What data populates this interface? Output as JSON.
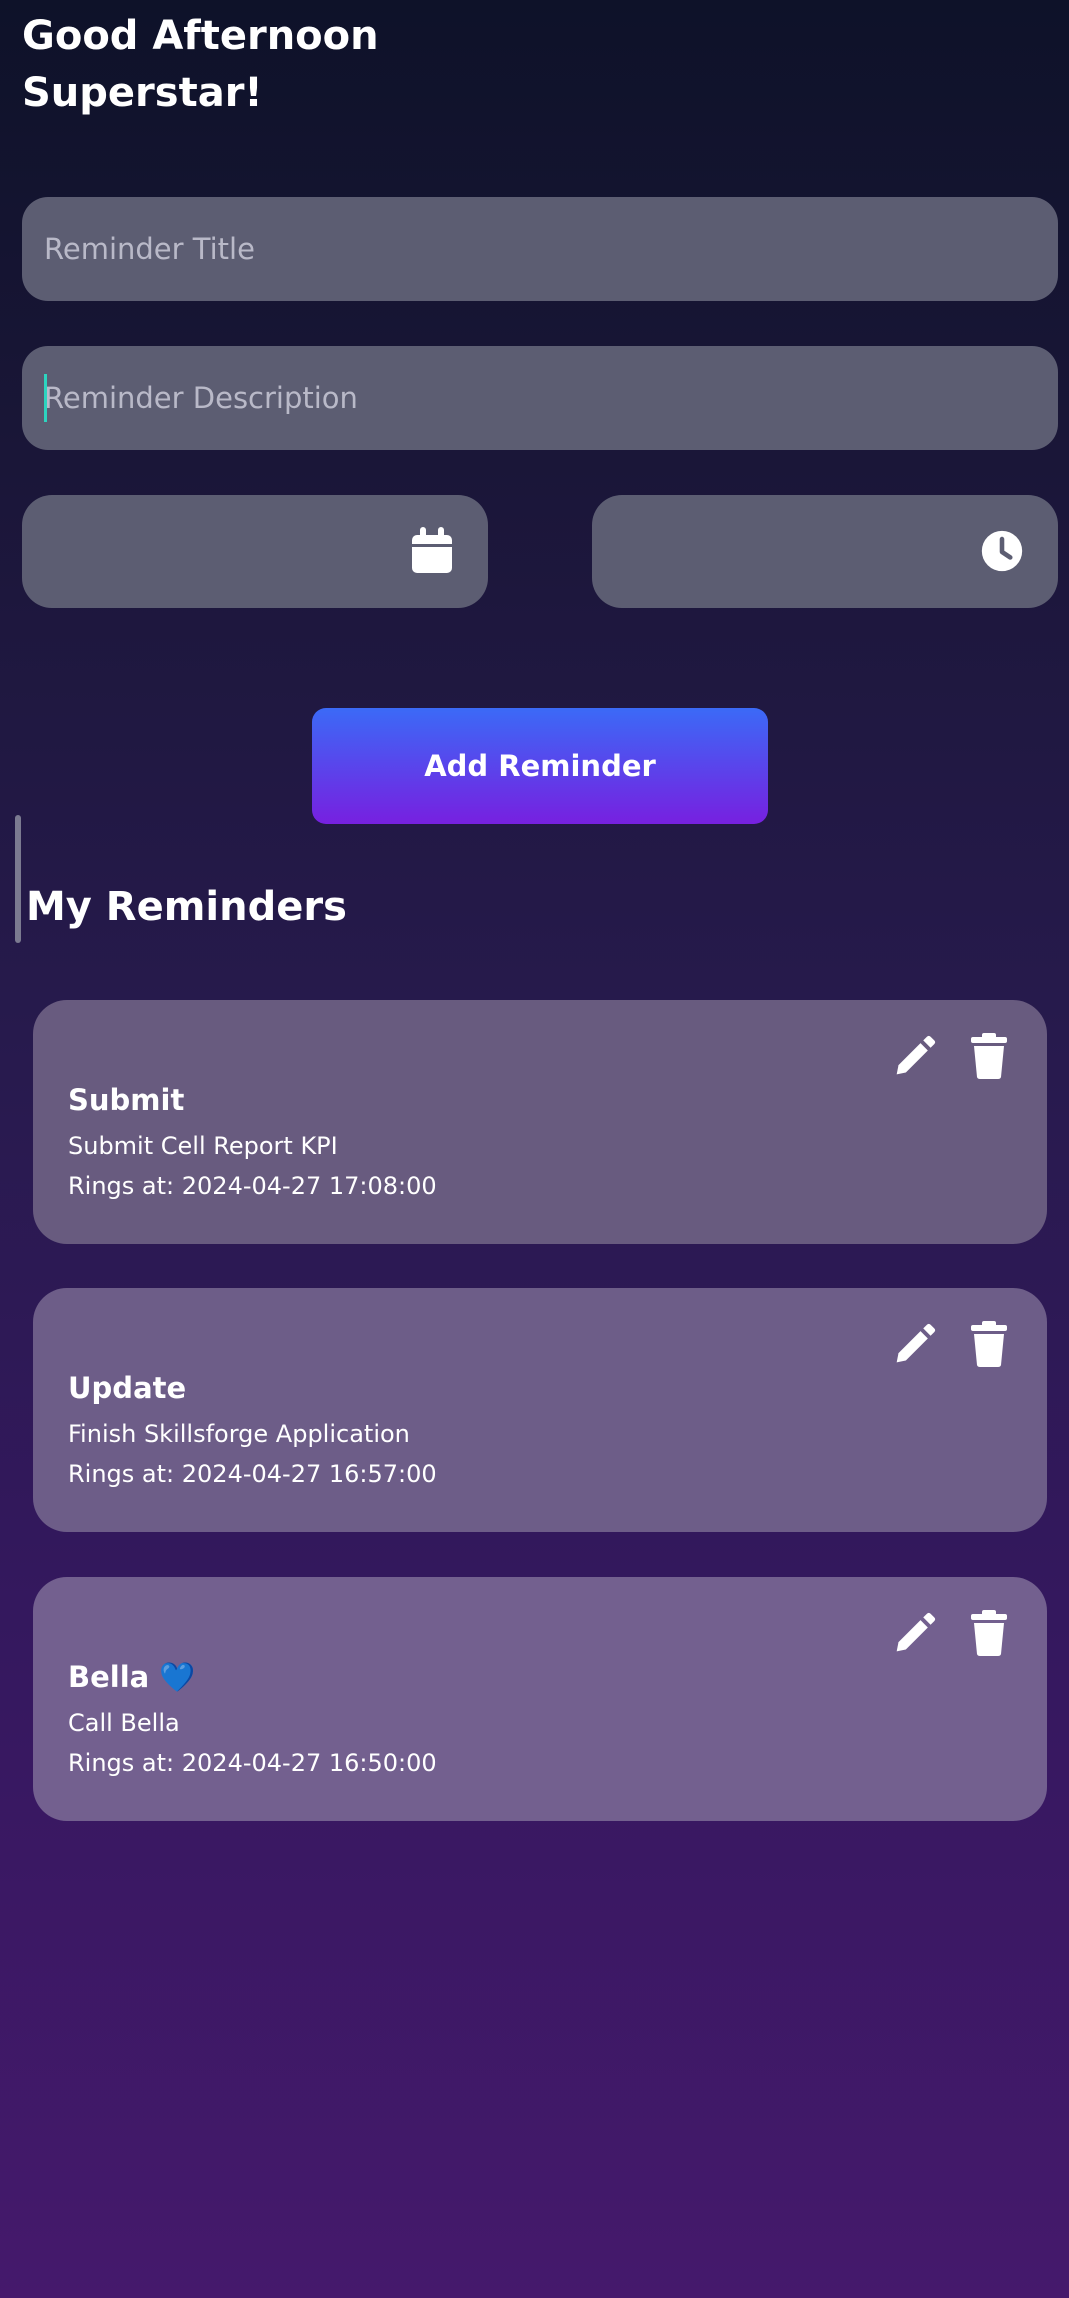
{
  "greeting": "Good Afternoon\nSuperstar!",
  "form": {
    "title_placeholder": "Reminder Title",
    "description_placeholder": "Reminder Description",
    "date_icon": "calendar-icon",
    "time_icon": "clock-icon",
    "add_button_label": "Add Reminder"
  },
  "reminders_section": {
    "title": "My Reminders",
    "items": [
      {
        "title": "Submit",
        "description": "Submit Cell Report KPI",
        "rings_at": "Rings at: 2024-04-27 17:08:00",
        "edit_icon": "pencil-icon",
        "delete_icon": "trash-icon"
      },
      {
        "title": "Update",
        "description": "Finish Skillsforge Application",
        "rings_at": "Rings at: 2024-04-27 16:57:00",
        "edit_icon": "pencil-icon",
        "delete_icon": "trash-icon"
      },
      {
        "title": "Bella 💙",
        "description": "Call Bella",
        "rings_at": "Rings at: 2024-04-27 16:50:00",
        "edit_icon": "pencil-icon",
        "delete_icon": "trash-icon"
      }
    ]
  },
  "colors": {
    "background_top": "#0e1229",
    "background_bottom": "#45196c",
    "input_bg": "#5c5d72",
    "button_gradient_start": "#3b6af7",
    "button_gradient_end": "#7720e0",
    "caret": "#2dd4bf"
  }
}
